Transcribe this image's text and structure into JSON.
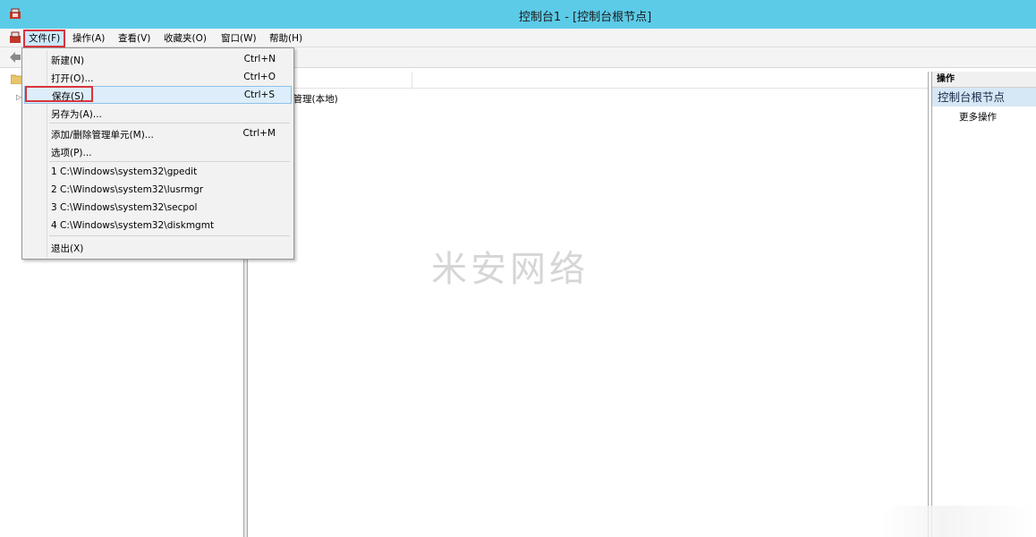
{
  "window": {
    "title": "控制台1 - [控制台根节点]"
  },
  "menubar": {
    "file": "文件(F)",
    "action": "操作(A)",
    "view": "查看(V)",
    "favorites": "收藏夹(O)",
    "window": "窗口(W)",
    "help": "帮助(H)"
  },
  "file_menu": {
    "new": {
      "label": "新建(N)",
      "shortcut": "Ctrl+N"
    },
    "open": {
      "label": "打开(O)...",
      "shortcut": "Ctrl+O"
    },
    "save": {
      "label": "保存(S)",
      "shortcut": "Ctrl+S"
    },
    "save_as": {
      "label": "另存为(A)..."
    },
    "add_remove_snapin": {
      "label": "添加/删除管理单元(M)...",
      "shortcut": "Ctrl+M"
    },
    "options": {
      "label": "选项(P)..."
    },
    "recent": [
      "1 C:\\Windows\\system32\\gpedit",
      "2 C:\\Windows\\system32\\lusrmgr",
      "3 C:\\Windows\\system32\\secpol",
      "4 C:\\Windows\\system32\\diskmgmt"
    ],
    "exit": {
      "label": "退出(X)"
    }
  },
  "center": {
    "item": "机管理(本地)"
  },
  "watermark": "米安网络",
  "actions_pane": {
    "header": "操作",
    "section": "控制台根节点",
    "more": "更多操作"
  },
  "colors": {
    "titlebar": "#5ccbe8",
    "highlight_box": "#d9343d",
    "selection": "#ddeefa"
  }
}
